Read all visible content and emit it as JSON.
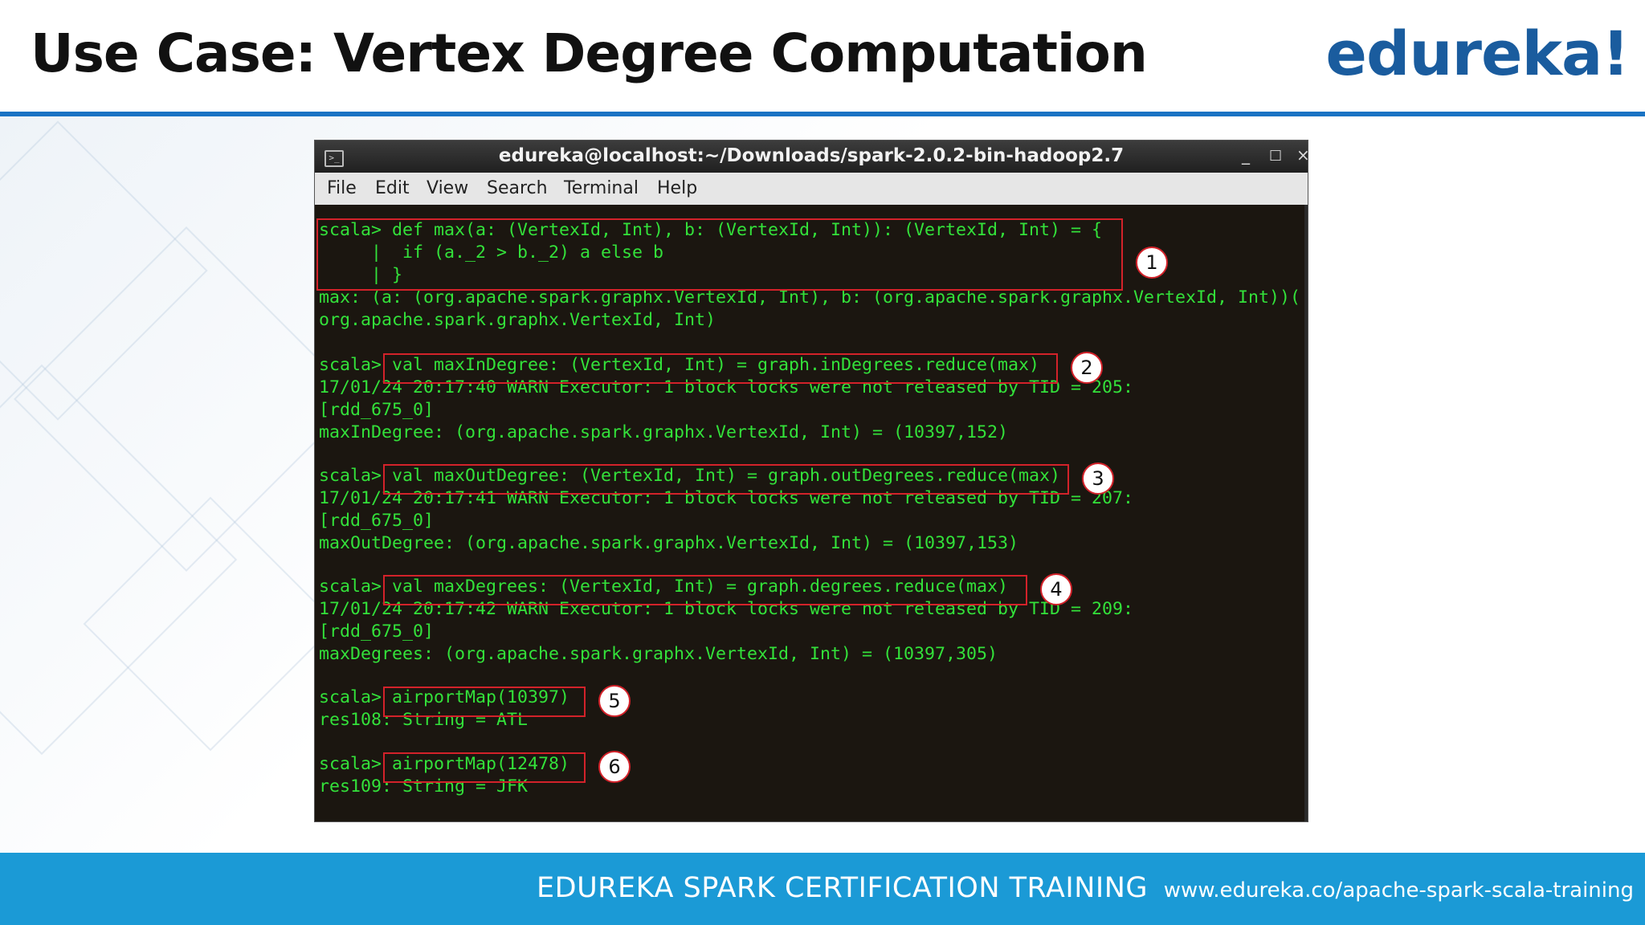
{
  "slide": {
    "title": "Use Case: Vertex Degree Computation",
    "logo": "edureka!"
  },
  "terminal": {
    "title": "edureka@localhost:~/Downloads/spark-2.0.2-bin-hadoop2.7",
    "menu": [
      "File",
      "Edit",
      "View",
      "Search",
      "Terminal",
      "Help"
    ],
    "lines": [
      "scala> def max(a: (VertexId, Int), b: (VertexId, Int)): (VertexId, Int) = {",
      "     |  if (a._2 > b._2) a else b",
      "     | }",
      "max: (a: (org.apache.spark.graphx.VertexId, Int), b: (org.apache.spark.graphx.VertexId, Int))(",
      "org.apache.spark.graphx.VertexId, Int)",
      "",
      "scala> val maxInDegree: (VertexId, Int) = graph.inDegrees.reduce(max)",
      "17/01/24 20:17:40 WARN Executor: 1 block locks were not released by TID = 205:",
      "[rdd_675_0]",
      "maxInDegree: (org.apache.spark.graphx.VertexId, Int) = (10397,152)",
      "",
      "scala> val maxOutDegree: (VertexId, Int) = graph.outDegrees.reduce(max)",
      "17/01/24 20:17:41 WARN Executor: 1 block locks were not released by TID = 207:",
      "[rdd_675_0]",
      "maxOutDegree: (org.apache.spark.graphx.VertexId, Int) = (10397,153)",
      "",
      "scala> val maxDegrees: (VertexId, Int) = graph.degrees.reduce(max)",
      "17/01/24 20:17:42 WARN Executor: 1 block locks were not released by TID = 209:",
      "[rdd_675_0]",
      "maxDegrees: (org.apache.spark.graphx.VertexId, Int) = (10397,305)",
      "",
      "scala> airportMap(10397)",
      "res108: String = ATL",
      "",
      "scala> airportMap(12478)",
      "res109: String = JFK"
    ],
    "callouts": [
      "1",
      "2",
      "3",
      "4",
      "5",
      "6"
    ]
  },
  "footer": {
    "title": "EDUREKA SPARK CERTIFICATION TRAINING",
    "url": "www.edureka.co/apache-spark-scala-training"
  },
  "colors": {
    "accent": "#1a73c4",
    "footer": "#1b9ad6",
    "terminal_text": "#33e13a",
    "highlight": "#d3222a"
  }
}
